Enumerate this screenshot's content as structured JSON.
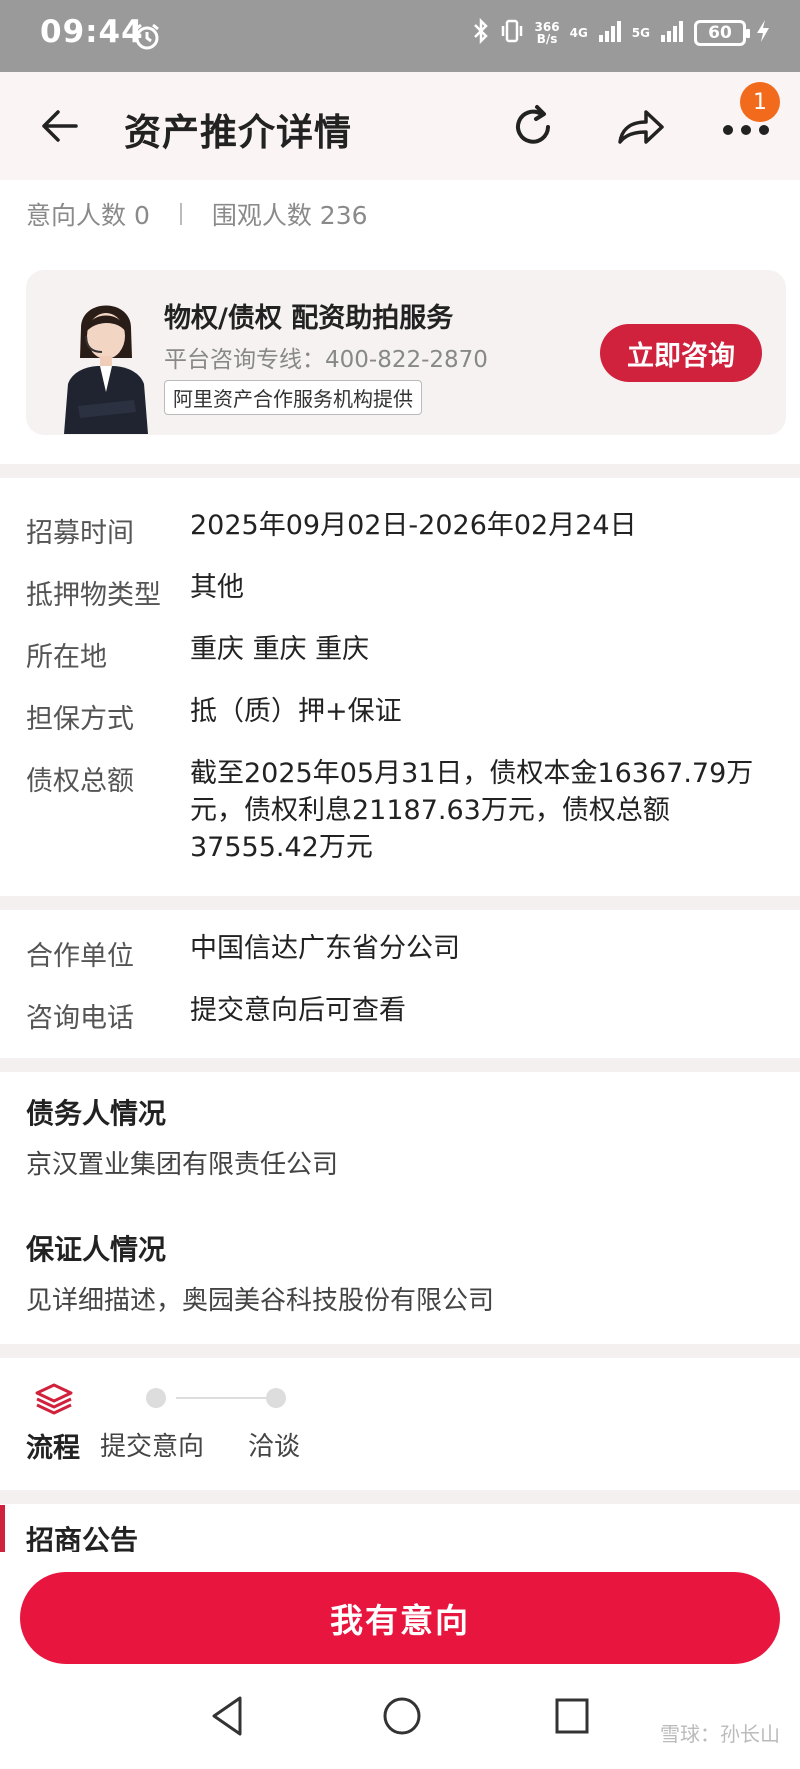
{
  "status_bar": {
    "time": "09:44",
    "net_speed_top": "366",
    "net_speed_bottom": "B/s",
    "net1": "4G",
    "net2": "5G",
    "battery": "60"
  },
  "nav": {
    "title": "资产推介详情",
    "badge_count": "1",
    "icons": [
      "back-arrow-icon",
      "refresh-icon",
      "share-icon",
      "more-icon"
    ]
  },
  "counts": {
    "intent_label": "意向人数 0",
    "view_label": "围观人数 236"
  },
  "consult": {
    "title": "物权/债权 配资助拍服务",
    "phone_label": "平台咨询专线：400-822-2870",
    "tag": "阿里资产合作服务机构提供",
    "button": "立即咨询"
  },
  "details": [
    {
      "label": "招募时间",
      "value": "2025年09月02日-2026年02月24日"
    },
    {
      "label": "抵押物类型",
      "value": "其他"
    },
    {
      "label": "所在地",
      "value": "重庆 重庆 重庆"
    },
    {
      "label": "担保方式",
      "value": "抵（质）押+保证"
    },
    {
      "label": "债权总额",
      "value": "截至2025年05月31日，债权本金16367.79万元，债权利息21187.63万元，债权总额37555.42万元"
    }
  ],
  "partner": [
    {
      "label": "合作单位",
      "value": "中国信达广东省分公司"
    },
    {
      "label": "咨询电话",
      "value": "提交意向后可查看"
    }
  ],
  "debtor": {
    "title": "债务人情况",
    "text": "京汉置业集团有限责任公司"
  },
  "guarantor": {
    "title": "保证人情况",
    "text": "见详细描述，奥园美谷科技股份有限公司"
  },
  "flow": {
    "label": "流程",
    "step1": "提交意向",
    "step2": "洽谈"
  },
  "notice": {
    "title": "招商公告"
  },
  "action": {
    "intent_button": "我有意向"
  },
  "watermark": "雪球：孙长山",
  "colors": {
    "accent": "#d0223d",
    "button": "#e8163f",
    "badge": "#f26a1b"
  }
}
